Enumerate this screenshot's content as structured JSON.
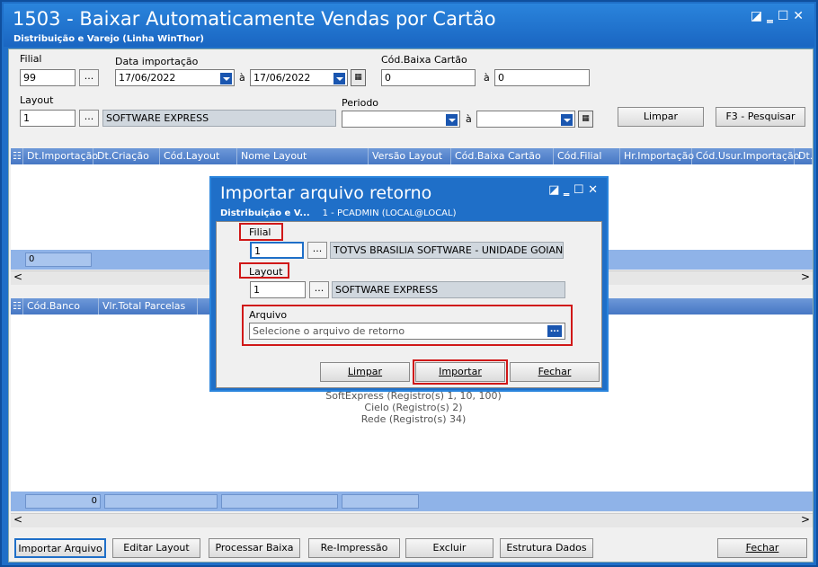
{
  "window": {
    "title": "1503 - Baixar Automaticamente Vendas por Cartão",
    "subtitle": "Distribuição e Varejo (Linha WinThor)",
    "controls": "◪ ‗ ☐ ✕"
  },
  "filters": {
    "filial_label": "Filial",
    "filial_value": "99",
    "data_label": "Data importação",
    "data_de": "17/06/2022",
    "a1": "à",
    "data_ate": "17/06/2022",
    "cod_label": "Cód.Baixa Cartão",
    "cod_de": "0",
    "a2": "à",
    "cod_ate": "0",
    "layout_label": "Layout",
    "layout_value": "1",
    "layout_name": "SOFTWARE EXPRESS",
    "periodo_label": "Periodo",
    "periodo_de": "",
    "a3": "à",
    "periodo_ate": "",
    "dots": "...",
    "limpar": "Limpar",
    "pesquisar": "F3 - Pesquisar"
  },
  "grid1": {
    "columns": [
      "Dt.Importação",
      "Dt.Criação",
      "Cód.Layout",
      "Nome Layout",
      "Versão Layout",
      "Cód.Baixa Cartão",
      "Cód.Filial",
      "Hr.Importação",
      "Cód.Usur.Importação",
      "Dt."
    ],
    "total": "0"
  },
  "grid2": {
    "columns": [
      "Cód.Banco",
      "Vlr.Total Parcelas"
    ],
    "total": "0"
  },
  "info": [
    "SoftExpress (Registro(s) 1, 10, 100)",
    "Cielo (Registro(s) 2)",
    "Rede (Registro(s) 34)"
  ],
  "footer": {
    "importar": "Importar Arquivo",
    "editar": "Editar Layout",
    "processar": "Processar Baixa",
    "reimpressao": "Re-Impressão",
    "excluir": "Excluir",
    "estrutura": "Estrutura Dados",
    "fechar": "Fechar"
  },
  "dialog": {
    "title": "Importar arquivo retorno",
    "subtitle": "Distribuição e V...",
    "user": "1 - PCADMIN (LOCAL@LOCAL)",
    "controls": "◪ ‗ ☐ ✕",
    "filial_label": "Filial",
    "filial_value": "1",
    "filial_name": "TOTVS BRASILIA SOFTWARE - UNIDADE GOIANI",
    "layout_label": "Layout",
    "layout_value": "1",
    "layout_name": "SOFTWARE EXPRESS",
    "arquivo_label": "Arquivo",
    "arquivo_placeholder": "Selecione o arquivo de retorno",
    "limpar": "Limpar",
    "importar": "Importar",
    "fechar": "Fechar",
    "dots": "..."
  },
  "scroll": {
    "left": "<",
    "right": ">"
  },
  "colors": {
    "accent": "#1f6fc8",
    "highlight": "#d01818"
  }
}
